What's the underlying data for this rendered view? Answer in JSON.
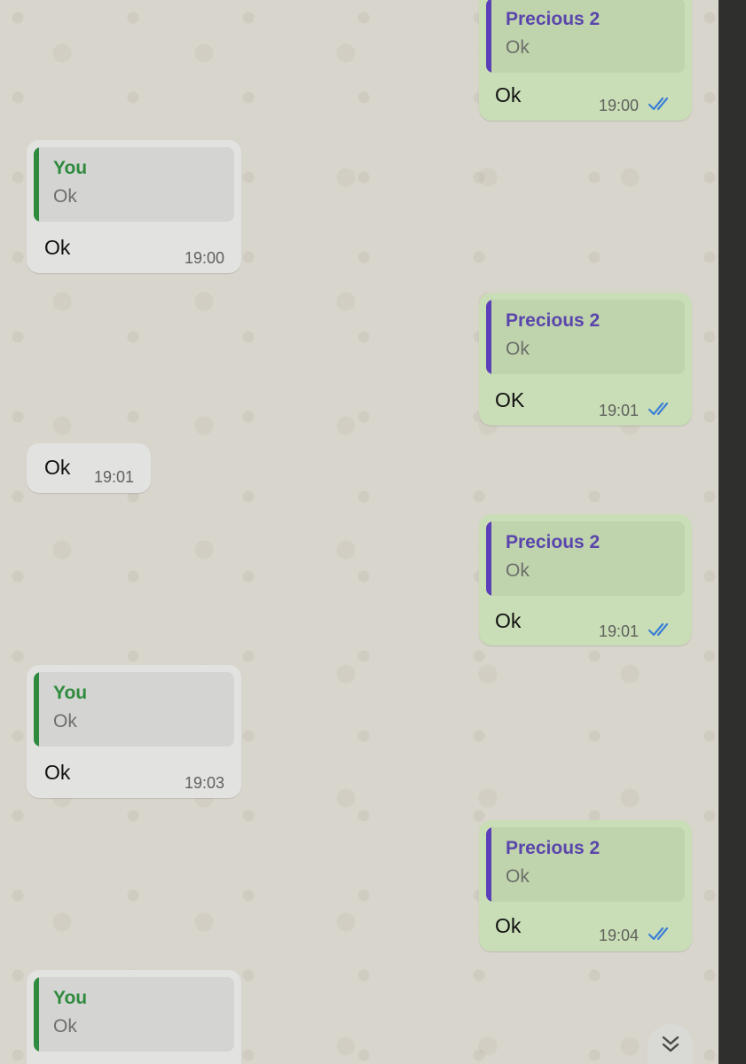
{
  "messages": [
    {
      "dir": "out",
      "quote_author": "Precious 2",
      "quote_text": "Ok",
      "text": "Ok",
      "time": "19:00",
      "status_icon": "double-check-icon"
    },
    {
      "dir": "in",
      "quote_author": "You",
      "quote_text": "Ok",
      "text": "Ok",
      "time": "19:00"
    },
    {
      "dir": "out",
      "quote_author": "Precious 2",
      "quote_text": "Ok",
      "text": "OK",
      "time": "19:01",
      "status_icon": "double-check-icon"
    },
    {
      "dir": "in",
      "text": "Ok",
      "time": "19:01"
    },
    {
      "dir": "out",
      "quote_author": "Precious 2",
      "quote_text": "Ok",
      "text": "Ok",
      "time": "19:01",
      "status_icon": "double-check-icon"
    },
    {
      "dir": "in",
      "quote_author": "You",
      "quote_text": "Ok",
      "text": "Ok",
      "time": "19:03"
    },
    {
      "dir": "out",
      "quote_author": "Precious 2",
      "quote_text": "Ok",
      "text": "Ok",
      "time": "19:04",
      "status_icon": "double-check-icon"
    },
    {
      "dir": "in",
      "quote_author": "You",
      "quote_text": "Ok"
    }
  ],
  "scroll_button_icon": "chevron-double-down-icon",
  "colors": {
    "outgoing_bubble": "#c9ddb6",
    "incoming_bubble": "#e2e2e0",
    "contact_name": "#5a45ad",
    "self_name": "#2e8b3e",
    "read_ticks": "#3b7fd6"
  }
}
